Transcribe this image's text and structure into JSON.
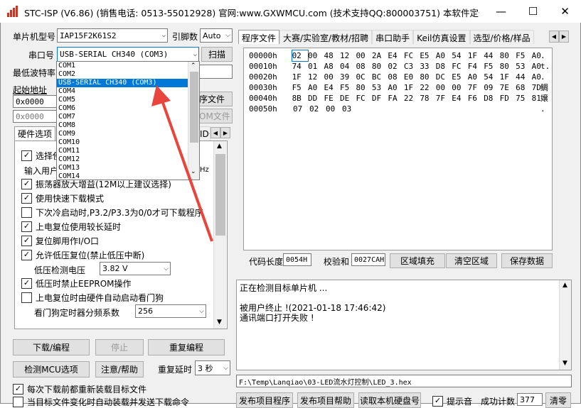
{
  "window": {
    "title": "STC-ISP (V6.86) (销售电话: 0513-55012928) 官网:www.GXWMCU.com  (技术支持QQ:800003751) 本软件定价: 6...",
    "minimize": "—",
    "maximize": "☐",
    "close": "✕"
  },
  "left": {
    "mcu_type_label": "单片机型号",
    "mcu_type_value": "IAP15F2K61S2",
    "pin_label": "引脚数",
    "pin_value": "Auto",
    "port_label": "串口号",
    "port_value": "USB-SERIAL CH340 (COM3)",
    "scan_button": "扫描",
    "min_baud_label": "最低波特率",
    "start_addr_label": "起始地址",
    "start_addr_1": "0x0000",
    "start_addr_2": "0x0000",
    "open_prog_file": "序文件",
    "open_eeprom_file": "OM文件",
    "port_dropdown": [
      "COM1",
      "COM2",
      "USB-SERIAL CH340 (COM3)",
      "COM4",
      "COM5",
      "COM6",
      "COM7",
      "COM8",
      "COM9",
      "COM10",
      "COM11",
      "COM12",
      "COM13",
      "COM14"
    ],
    "port_dropdown_selected_index": 2
  },
  "hw_tabs": {
    "active": "硬件选项",
    "partial": "ID号"
  },
  "hw_options": {
    "opt_select": "选择使",
    "input_freq_label": "输入用户",
    "freq_unit": "Hz",
    "opt1": "振荡器放大增益(12M以上建议选择)",
    "opt2": "使用快速下载模式",
    "opt3": "下次冷启动时,P3.2/P3.3为0/0才可下载程序",
    "opt4": "上电复位使用较长延时",
    "opt5": "复位脚用作I/O口",
    "opt6": "允许低压复位(禁止低压中断)",
    "low_volt_label": "低压检测电压",
    "low_volt_value": "3.82 V",
    "opt7": "低压时禁止EEPROM操作",
    "opt8": "上电复位时由硬件自动启动看门狗",
    "wdt_label": "看门狗定时器分频系数",
    "wdt_value": "256"
  },
  "bottom_left": {
    "download": "下载/编程",
    "stop": "停止",
    "reprogram": "重复编程",
    "detect": "检测MCU选项",
    "help": "注意/帮助",
    "repeat_delay_label": "重复延时",
    "repeat_delay_value": "3 秒",
    "reload_check": "每次下载前都重新装载目标文件",
    "auto_send_check": "当目标文件变化时自动装载并发送下载命令"
  },
  "right_tabs": [
    "程序文件",
    "大赛/实验室/教材/招聘",
    "串口助手",
    "Keil仿真设置",
    "选型/价格/样品"
  ],
  "hex": {
    "rows": [
      {
        "addr": "00000h",
        "bytes": [
          "02",
          "00",
          "48",
          "12",
          "00",
          "2A",
          "E4",
          "FC",
          "E5",
          "A0",
          "54",
          "1F",
          "44",
          "80",
          "F5",
          "A0"
        ],
        "ascii": "."
      },
      {
        "addr": "00010h",
        "bytes": [
          "74",
          "01",
          "A8",
          "04",
          "08",
          "80",
          "02",
          "C3",
          "33",
          "D8",
          "FC",
          "F4",
          "F5",
          "80",
          "53",
          "A0"
        ],
        "ascii": "t."
      },
      {
        "addr": "00020h",
        "bytes": [
          "1F",
          "12",
          "00",
          "39",
          "0C",
          "BC",
          "08",
          "E0",
          "80",
          "DC",
          "E5",
          "A0",
          "54",
          "1F",
          "44",
          "A0"
        ],
        "ascii": "."
      },
      {
        "addr": "00030h",
        "bytes": [
          "F5",
          "A0",
          "E4",
          "F5",
          "80",
          "53",
          "A0",
          "1F",
          "22",
          "00",
          "00",
          "7F",
          "09",
          "7E",
          "68",
          "7D"
        ],
        "ascii": "鲷"
      },
      {
        "addr": "00040h",
        "bytes": [
          "8B",
          "DD",
          "FE",
          "DE",
          "FC",
          "DF",
          "FA",
          "22",
          "78",
          "7F",
          "E4",
          "F6",
          "D8",
          "FD",
          "75",
          "81"
        ],
        "ascii": "嬢"
      },
      {
        "addr": "00050h",
        "bytes": [
          "07",
          "02",
          "00",
          "03"
        ],
        "ascii": "."
      }
    ],
    "code_len_label": "代码长度",
    "code_len_value": "0054H",
    "checksum_label": "校验和",
    "checksum_value": "0027CAH",
    "fill_button": "区域填充",
    "clear_button": "清空区域",
    "save_button": "保存数据"
  },
  "log": {
    "lines": [
      "正在检测目标单片机 ...",
      "",
      "被用户终止 !(2021-01-18 17:46:42)",
      "通讯端口打开失败 !"
    ]
  },
  "file_path": "F:\\Temp\\Lanqiao\\03-LED流水灯控制\\LED_3.hex",
  "bottom_right": {
    "publish_prog": "发布项目程序",
    "publish_help": "发布项目帮助",
    "read_disk": "读取本机硬盘号",
    "sound_label": "提示音",
    "success_label": "成功计数",
    "success_value": "377",
    "clear": "清零"
  },
  "colors": {
    "arrow": "#e8463c",
    "selection": "#0078d7",
    "title_icon": "#c0392b"
  }
}
